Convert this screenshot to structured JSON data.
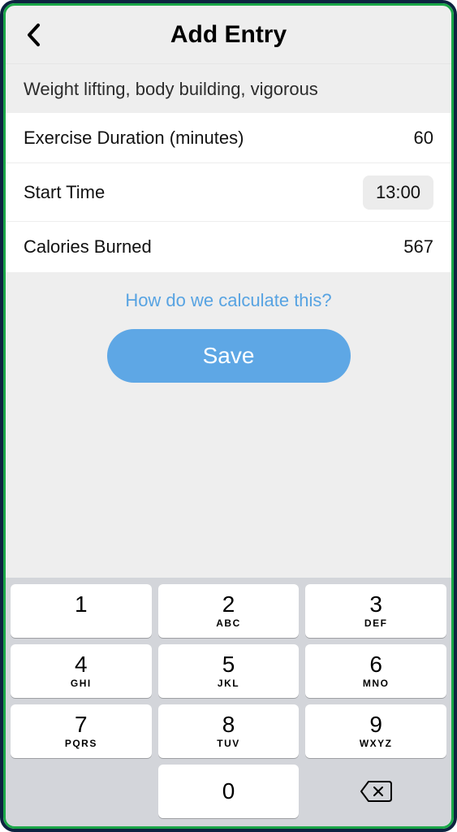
{
  "header": {
    "title": "Add Entry"
  },
  "exercise": {
    "name": "Weight lifting, body building, vigorous"
  },
  "fields": {
    "duration": {
      "label": "Exercise Duration (minutes)",
      "value": "60"
    },
    "start_time": {
      "label": "Start Time",
      "value": "13:00"
    },
    "calories": {
      "label": "Calories Burned",
      "value": "567"
    }
  },
  "links": {
    "calc_info": "How do we calculate this?"
  },
  "buttons": {
    "save": "Save"
  },
  "keyboard": {
    "keys": [
      {
        "digit": "1",
        "letters": ""
      },
      {
        "digit": "2",
        "letters": "ABC"
      },
      {
        "digit": "3",
        "letters": "DEF"
      },
      {
        "digit": "4",
        "letters": "GHI"
      },
      {
        "digit": "5",
        "letters": "JKL"
      },
      {
        "digit": "6",
        "letters": "MNO"
      },
      {
        "digit": "7",
        "letters": "PQRS"
      },
      {
        "digit": "8",
        "letters": "TUV"
      },
      {
        "digit": "9",
        "letters": "WXYZ"
      },
      {
        "digit": "0",
        "letters": ""
      }
    ]
  }
}
